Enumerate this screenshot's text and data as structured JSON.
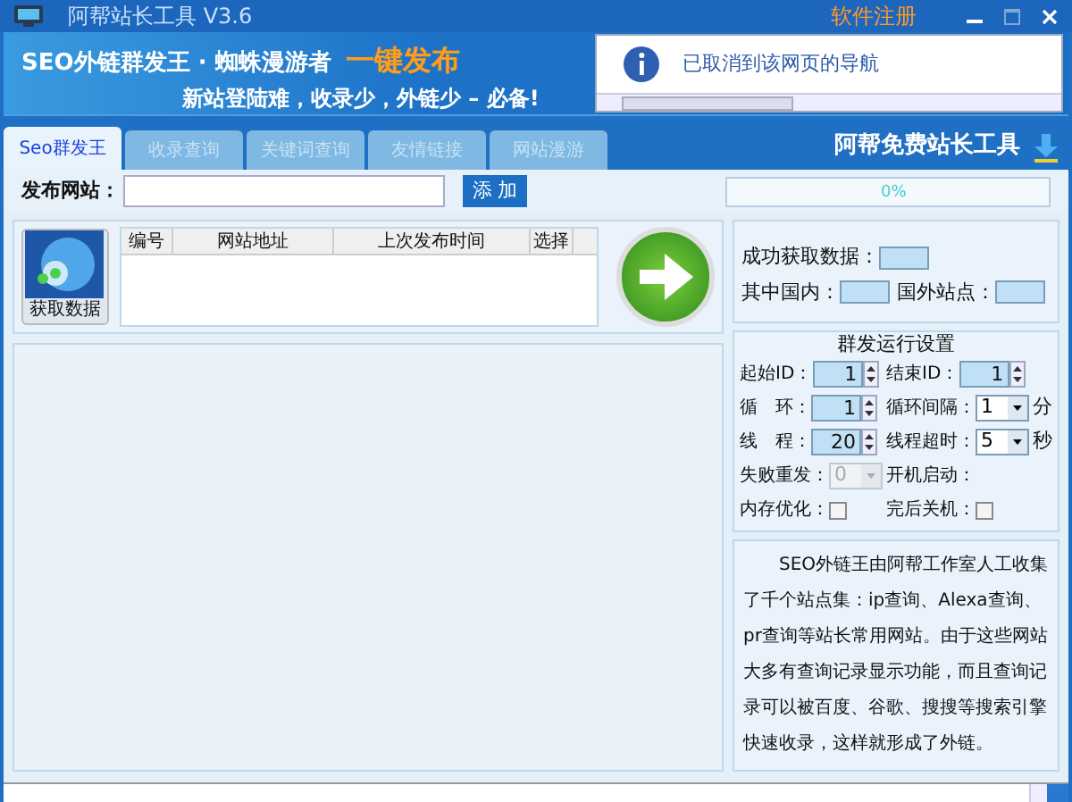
{
  "window": {
    "title": "阿帮站长工具 V3.6",
    "register": "软件注册"
  },
  "banner": {
    "headline": "SEO外链群发王 · 蜘蛛漫游者",
    "highlight": "一键发布",
    "slogan": "新站登陆难，收录少，外链少 – 必备!",
    "browser_message": "已取消到该网页的导航"
  },
  "tabs": [
    {
      "label": "Seo群发王",
      "selected": true
    },
    {
      "label": "收录查询",
      "selected": false
    },
    {
      "label": "关键词查询",
      "selected": false
    },
    {
      "label": "友情链接",
      "selected": false
    },
    {
      "label": "网站漫游",
      "selected": false
    }
  ],
  "brand": "阿帮免费站长工具",
  "toolbar": {
    "label": "发布网站：",
    "add_button": "添 加",
    "progress": {
      "level": 0,
      "reading": "0%"
    }
  },
  "fetch_button": "获取数据",
  "table": {
    "columns": [
      "编号",
      "网站地址",
      "上次发布时间",
      "选择"
    ]
  },
  "stats": {
    "success": "成功获取数据：",
    "domestic": "其中国内：",
    "foreign": "国外站点："
  },
  "settings": {
    "title": "群发运行设置",
    "items": [
      {
        "kind": "spinner",
        "label": "起始ID：",
        "value": "1"
      },
      {
        "kind": "spinner",
        "label": "结束ID：",
        "value": "1"
      },
      {
        "kind": "spinner",
        "label": "循　环：",
        "value": "1"
      },
      {
        "kind": "select",
        "label": "循环间隔：",
        "value": "1",
        "unit": "分",
        "disabled": false
      },
      {
        "kind": "spinner",
        "label": "线　程：",
        "value": "20"
      },
      {
        "kind": "select",
        "label": "线程超时：",
        "value": "5",
        "unit": "秒",
        "disabled": false
      },
      {
        "kind": "select",
        "label": "失败重发：",
        "value": "0",
        "disabled": true
      },
      {
        "kind": "label",
        "label": "开机启动："
      },
      {
        "kind": "checkbox",
        "label": "内存优化：",
        "checked": false
      },
      {
        "kind": "checkbox",
        "label": "完后关机：",
        "checked": false
      }
    ]
  },
  "description": "SEO外链王由阿帮工作室人工收集了千个站点集：ip查询、Alexa查询、pr查询等站长常用网站。由于这些网站大多有查询记录显示功能，而且查询记录可以被百度、谷歌、搜搜等搜索引擎快速收录，这样就形成了外链。"
}
